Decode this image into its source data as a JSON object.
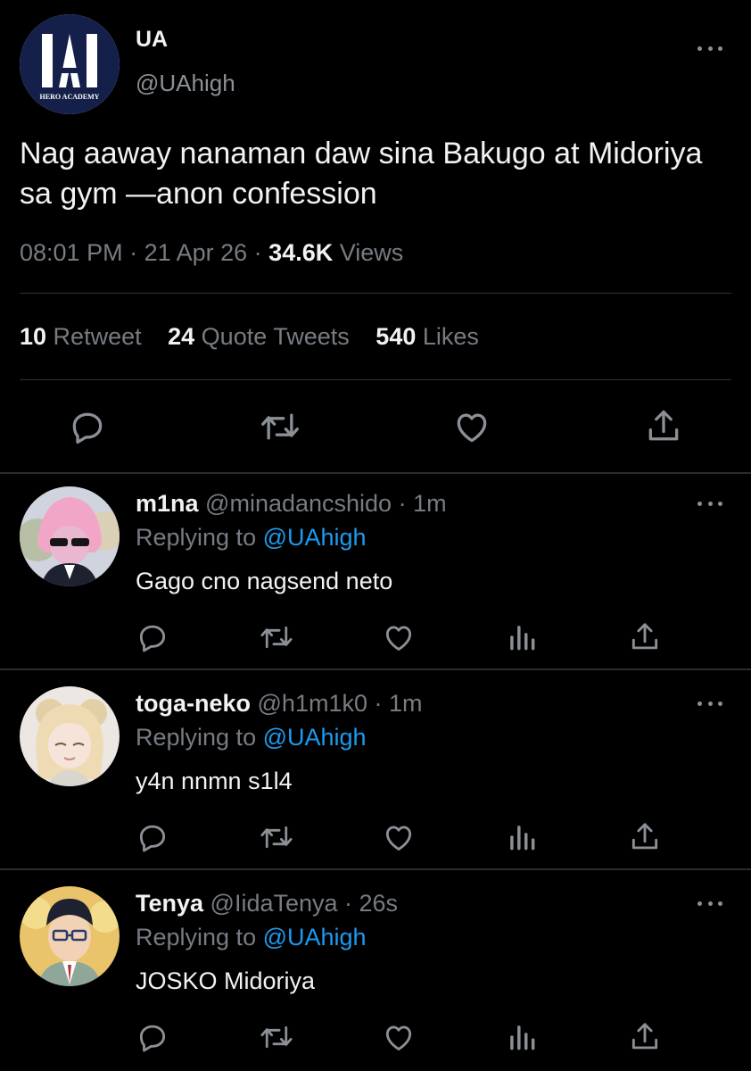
{
  "main_tweet": {
    "avatar_text": "UA",
    "avatar_subtext": "HERO ACADEMY",
    "display_name": "UA",
    "handle": "@UAhigh",
    "text": "Nag aaway nanaman daw sina Bakugo at Midoriya sa gym —anon confession",
    "time": "08:01 PM",
    "sep1": " · ",
    "date": "21 Apr 26",
    "sep2": " · ",
    "views_count": "34.6K",
    "views_label": " Views",
    "stats": {
      "retweets": "10",
      "retweets_label": " Retweet",
      "quotes": "24",
      "quotes_label": " Quote Tweets",
      "likes": "540",
      "likes_label": " Likes"
    },
    "icons": [
      "reply-icon",
      "retweet-icon",
      "like-icon",
      "share-icon"
    ]
  },
  "replies": [
    {
      "name": "m1na",
      "handle": " @minadancshido",
      "time": " · 1m",
      "replying_prefix": "Replying to ",
      "replying_to": "@UAhigh",
      "text": "Gago cno nagsend neto"
    },
    {
      "name": "toga-neko",
      "handle": " @h1m1k0",
      "time": " · 1m",
      "replying_prefix": "Replying to ",
      "replying_to": "@UAhigh",
      "text": "y4n nnmn s1l4"
    },
    {
      "name": "Tenya",
      "handle": " @IidaTenya",
      "time": " · 26s",
      "replying_prefix": "Replying to ",
      "replying_to": "@UAhigh",
      "text": "JOSKO Midoriya"
    }
  ],
  "colors": {
    "background": "#000000",
    "text": "#f2f2f2",
    "muted": "#777c82",
    "link": "#1d9bf0",
    "divider": "#2f3336",
    "ua_blue": "#14204a"
  }
}
